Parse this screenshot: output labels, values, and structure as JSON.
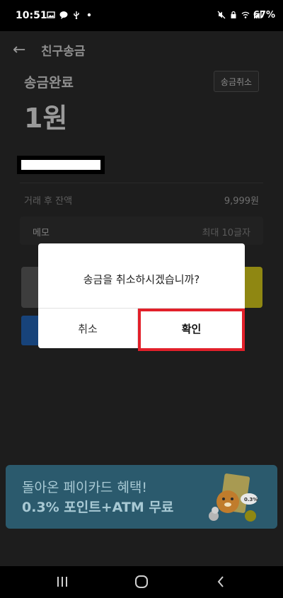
{
  "status_bar": {
    "time": "10:51",
    "battery": "67%",
    "left_icons": [
      "image-icon",
      "chat-icon",
      "usb-icon",
      "dot-icon"
    ],
    "right_icons": [
      "mute-icon",
      "lock-icon",
      "wifi-icon",
      "signal-icon",
      "battery-icon"
    ]
  },
  "header": {
    "title": "친구송금"
  },
  "transfer": {
    "status": "송금완료",
    "amount": "1원",
    "cancel_button": "송금취소"
  },
  "balance": {
    "label": "거래 후 잔액",
    "value": "9,999원"
  },
  "memo": {
    "label": "메모",
    "placeholder": "최대 10글자"
  },
  "dialog": {
    "message": "송금을 취소하시겠습니까?",
    "cancel_label": "취소",
    "confirm_label": "확인"
  },
  "banner": {
    "line1": "돌아온 페이카드 혜택!",
    "line2": "0.3% 포인트+ATM 무료",
    "badge": "0.3%"
  },
  "colors": {
    "highlight": "#e2202a",
    "banner_bg": "#2b5a6d",
    "kakao_yellow": "#8f8712"
  }
}
